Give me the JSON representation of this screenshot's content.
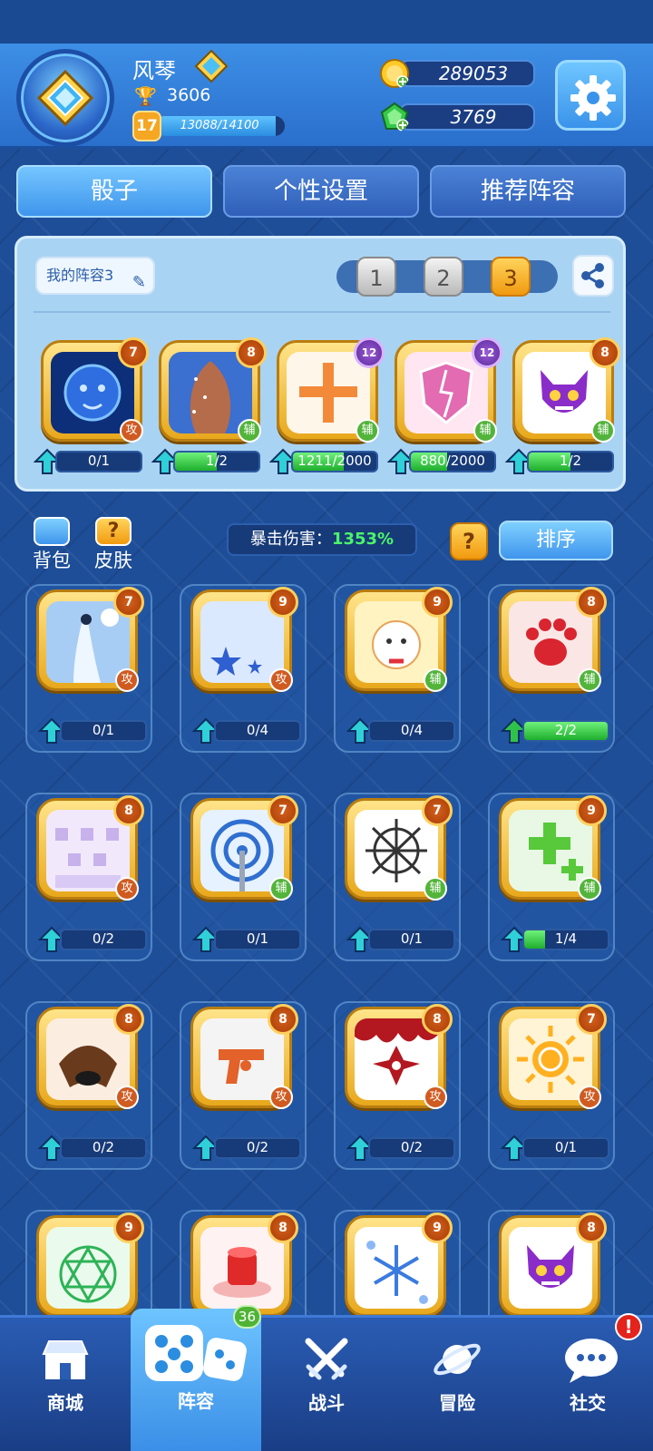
{
  "player": {
    "name": "风琴",
    "trophies": "3606",
    "level": "17",
    "xp_text": "13088/14100",
    "xp_fraction": 0.928,
    "gold": "289053",
    "gems": "3769",
    "rank_badge_icon": "diamond-rank-icon"
  },
  "tabs": [
    "骰子",
    "个性设置",
    "推荐阵容"
  ],
  "active_tab": 0,
  "lineup": {
    "my_lineup_label": "我的阵容3",
    "slots": [
      "1",
      "2",
      "3"
    ],
    "active_slot": 2,
    "dice": [
      {
        "name": "lion-dice",
        "level": "7",
        "type": "攻",
        "progress": "0/1",
        "fill": 0,
        "badge": "orange"
      },
      {
        "name": "constellation-dice",
        "level": "8",
        "type": "辅",
        "progress": "1/2",
        "fill": 0.5,
        "badge": "orange"
      },
      {
        "name": "holy-cross-dice",
        "level": "12",
        "type": "辅",
        "progress": "1211/2000",
        "fill": 0.605,
        "badge": "purple"
      },
      {
        "name": "broken-shield-dice",
        "level": "12",
        "type": "辅",
        "progress": "880/2000",
        "fill": 0.44,
        "badge": "purple"
      },
      {
        "name": "demon-dice",
        "level": "8",
        "type": "辅",
        "progress": "1/2",
        "fill": 0.5,
        "badge": "orange"
      }
    ]
  },
  "toolbar": {
    "bag_label": "背包",
    "skin_label": "皮肤",
    "crit_label": "暴击伤害：",
    "crit_value": "1353%",
    "help_label": "?",
    "sort_label": "排序"
  },
  "collection": [
    {
      "name": "moon-maiden-dice",
      "level": "7",
      "type": "攻",
      "progress": "0/1",
      "fill": 0
    },
    {
      "name": "star-dice",
      "level": "9",
      "type": "攻",
      "progress": "0/4",
      "fill": 0
    },
    {
      "name": "lucky-cat-dice",
      "level": "9",
      "type": "辅",
      "progress": "0/4",
      "fill": 0
    },
    {
      "name": "paw-dice",
      "level": "8",
      "type": "辅",
      "progress": "2/2",
      "fill": 1
    },
    {
      "name": "pixel-dice",
      "level": "8",
      "type": "攻",
      "progress": "0/2",
      "fill": 0
    },
    {
      "name": "signal-dice",
      "level": "7",
      "type": "辅",
      "progress": "0/1",
      "fill": 0
    },
    {
      "name": "thorn-web-dice",
      "level": "7",
      "type": "辅",
      "progress": "0/1",
      "fill": 0
    },
    {
      "name": "heal-dice",
      "level": "9",
      "type": "辅",
      "progress": "1/4",
      "fill": 0.25
    },
    {
      "name": "mask-dice",
      "level": "8",
      "type": "攻",
      "progress": "0/2",
      "fill": 0
    },
    {
      "name": "revolver-dice",
      "level": "8",
      "type": "攻",
      "progress": "0/2",
      "fill": 0
    },
    {
      "name": "shuriken-blood-dice",
      "level": "8",
      "type": "攻",
      "progress": "0/2",
      "fill": 0
    },
    {
      "name": "sun-dice",
      "level": "7",
      "type": "攻",
      "progress": "0/1",
      "fill": 0
    },
    {
      "name": "magic-circle-dice",
      "level": "9",
      "type": "",
      "progress": "",
      "fill": 0
    },
    {
      "name": "red-button-dice",
      "level": "8",
      "type": "",
      "progress": "",
      "fill": 0
    },
    {
      "name": "snowflake-dice",
      "level": "9",
      "type": "",
      "progress": "",
      "fill": 0
    },
    {
      "name": "demon-dice",
      "level": "8",
      "type": "",
      "progress": "",
      "fill": 0
    }
  ],
  "nav": {
    "items": [
      "商城",
      "阵容",
      "战斗",
      "冒险",
      "社交"
    ],
    "active": 1,
    "lineup_badge": "36",
    "social_alert": "!"
  },
  "colors": {
    "atk_tag": "#d05b21",
    "sup_tag": "#52b43a",
    "crit_value": "#4cf36a",
    "active_slot": "#f09a10"
  }
}
